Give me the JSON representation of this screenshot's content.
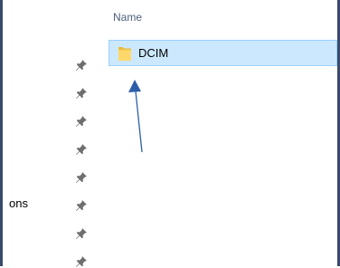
{
  "nav": {
    "partial_label": "ons"
  },
  "content": {
    "column_header": "Name",
    "rows": [
      {
        "name": "DCIM",
        "icon": "folder-icon",
        "selected": true
      }
    ]
  },
  "colors": {
    "selection_background": "#cce8ff",
    "selection_border": "#99d1ff",
    "arrow": "#2d5fa8",
    "window_border": "#3b4a6b"
  }
}
